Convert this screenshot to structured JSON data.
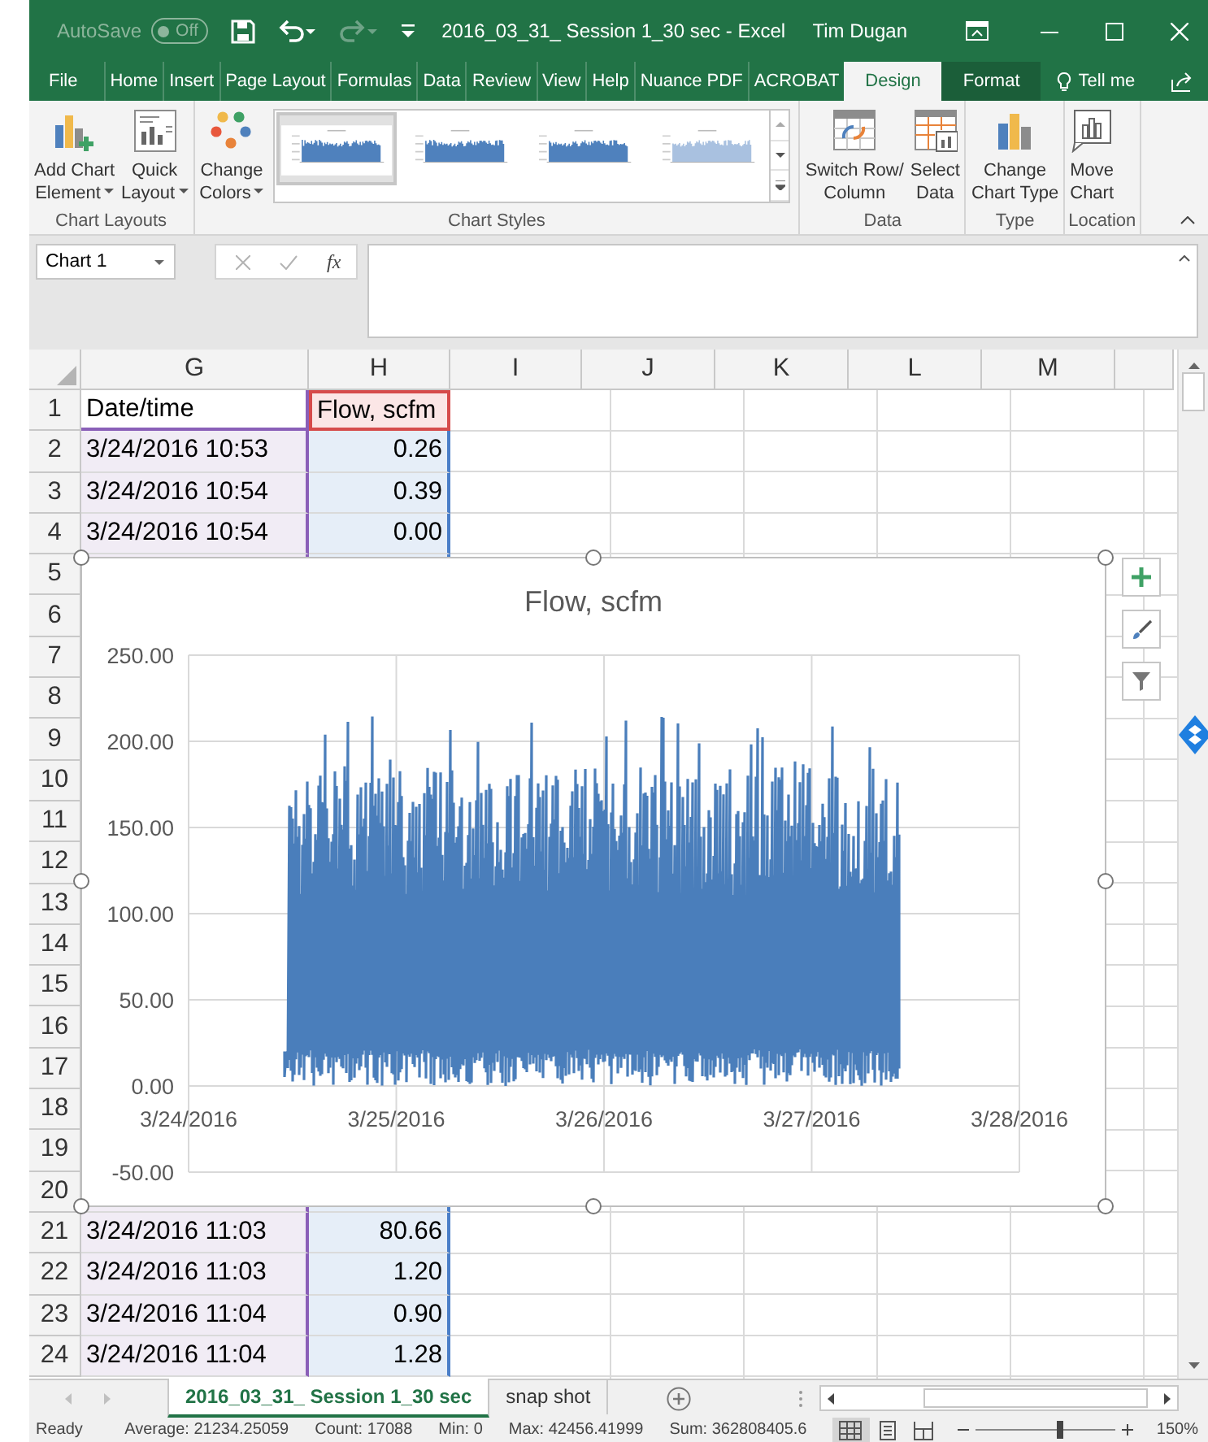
{
  "window": {
    "autosave_label": "AutoSave",
    "autosave_state": "Off",
    "title": "2016_03_31_ Session 1_30 sec  -  Excel",
    "user": "Tim Dugan"
  },
  "menu_tabs": [
    {
      "label": "File",
      "selected": false,
      "contextual": false
    },
    {
      "label": "Home",
      "selected": false,
      "contextual": false
    },
    {
      "label": "Insert",
      "selected": false,
      "contextual": false
    },
    {
      "label": "Page Layout",
      "selected": false,
      "contextual": false
    },
    {
      "label": "Formulas",
      "selected": false,
      "contextual": false
    },
    {
      "label": "Data",
      "selected": false,
      "contextual": false
    },
    {
      "label": "Review",
      "selected": false,
      "contextual": false
    },
    {
      "label": "View",
      "selected": false,
      "contextual": false
    },
    {
      "label": "Help",
      "selected": false,
      "contextual": false
    },
    {
      "label": "Nuance PDF",
      "selected": false,
      "contextual": false
    },
    {
      "label": "ACROBAT",
      "selected": false,
      "contextual": false
    },
    {
      "label": "Design",
      "selected": true,
      "contextual": true
    },
    {
      "label": "Format",
      "selected": false,
      "contextual": true
    }
  ],
  "tell_me": "Tell me",
  "ribbon_groups": [
    {
      "label": "Chart Layouts",
      "kind": "buttons",
      "buttons": [
        {
          "kind": "add-element",
          "lines": [
            "Add Chart",
            "Element"
          ],
          "dropdown": true
        },
        {
          "kind": "quick-layout",
          "lines": [
            "Quick",
            "Layout"
          ],
          "dropdown": true
        }
      ]
    },
    {
      "label": "Chart Styles",
      "kind": "styles",
      "buttons": [
        {
          "kind": "colors",
          "lines": [
            "Change",
            "Colors"
          ],
          "dropdown": true
        }
      ],
      "styles": [
        {
          "selected": true,
          "kind": "solid"
        },
        {
          "selected": false,
          "kind": "solid"
        },
        {
          "selected": false,
          "kind": "solid"
        },
        {
          "selected": false,
          "kind": "light"
        }
      ]
    },
    {
      "label": "Data",
      "kind": "buttons",
      "buttons": [
        {
          "kind": "switch",
          "lines": [
            "Switch Row/",
            "Column"
          ],
          "dropdown": false
        },
        {
          "kind": "select-data",
          "lines": [
            "Select",
            "Data"
          ],
          "dropdown": false
        }
      ]
    },
    {
      "label": "Type",
      "kind": "buttons",
      "buttons": [
        {
          "kind": "chart-type",
          "lines": [
            "Change",
            "Chart Type"
          ],
          "dropdown": false
        }
      ]
    },
    {
      "label": "Location",
      "kind": "buttons",
      "buttons": [
        {
          "kind": "move",
          "lines": [
            "Move",
            "Chart"
          ],
          "dropdown": false
        }
      ]
    }
  ],
  "formula_bar": {
    "name_box": "Chart 1",
    "function_button": "fx"
  },
  "columns": [
    {
      "label": "G",
      "kind": "category"
    },
    {
      "label": "H",
      "kind": "values"
    },
    {
      "label": "I"
    },
    {
      "label": "J"
    },
    {
      "label": "K"
    },
    {
      "label": "L"
    },
    {
      "label": "M"
    }
  ],
  "rows": [
    {
      "number": "1",
      "cells": [
        "Date/time",
        "Flow, scfm"
      ]
    },
    {
      "number": "2",
      "cells": [
        "3/24/2016 10:53",
        "0.26"
      ]
    },
    {
      "number": "3",
      "cells": [
        "3/24/2016 10:54",
        "0.39"
      ]
    },
    {
      "number": "4",
      "cells": [
        "3/24/2016 10:54",
        "0.00"
      ]
    },
    {
      "number": "5",
      "cells": []
    },
    {
      "number": "6",
      "cells": []
    },
    {
      "number": "7",
      "cells": []
    },
    {
      "number": "8",
      "cells": []
    },
    {
      "number": "9",
      "cells": []
    },
    {
      "number": "10",
      "cells": []
    },
    {
      "number": "11",
      "cells": []
    },
    {
      "number": "12",
      "cells": []
    },
    {
      "number": "13",
      "cells": []
    },
    {
      "number": "14",
      "cells": []
    },
    {
      "number": "15",
      "cells": []
    },
    {
      "number": "16",
      "cells": []
    },
    {
      "number": "17",
      "cells": []
    },
    {
      "number": "18",
      "cells": []
    },
    {
      "number": "19",
      "cells": []
    },
    {
      "number": "20",
      "cells": []
    },
    {
      "number": "21",
      "cells": [
        "3/24/2016 11:03",
        "80.66"
      ]
    },
    {
      "number": "22",
      "cells": [
        "3/24/2016 11:03",
        "1.20"
      ]
    },
    {
      "number": "23",
      "cells": [
        "3/24/2016 11:04",
        "0.90"
      ]
    },
    {
      "number": "24",
      "cells": [
        "3/24/2016 11:04",
        "1.28"
      ]
    }
  ],
  "chart": {
    "title": "Flow, scfm",
    "y_labels": [
      "250.00",
      "200.00",
      "150.00",
      "100.00",
      "50.00",
      "0.00",
      "-50.00"
    ],
    "x_labels": [
      "3/24/2016",
      "3/25/2016",
      "3/26/2016",
      "3/27/2016",
      "3/28/2016"
    ]
  },
  "sheet_tabs": [
    {
      "label": "2016_03_31_ Session 1_30 sec",
      "selected": true
    },
    {
      "label": "snap shot",
      "selected": false
    }
  ],
  "status_bar": {
    "mode": "Ready",
    "stats": [
      "Average: 21234.25059",
      "Count: 17088",
      "Min: 0",
      "Max: 42456.41999",
      "Sum: 362808405.6"
    ],
    "views": [
      {
        "kind": "normal",
        "selected": true
      },
      {
        "kind": "page-layout",
        "selected": false
      },
      {
        "kind": "page-break",
        "selected": false
      }
    ],
    "zoom": {
      "level": 0.6,
      "reading": "150%"
    }
  }
}
